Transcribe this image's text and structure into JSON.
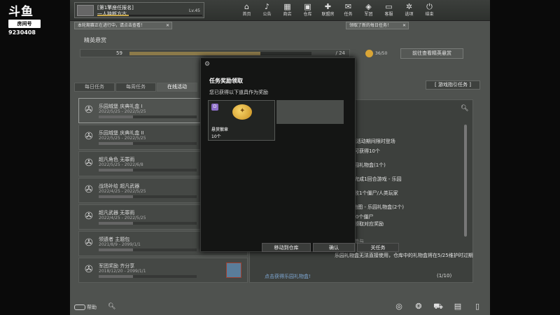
{
  "stream": {
    "brand": "斗鱼",
    "tag": "房间号",
    "room_number": "9230408"
  },
  "player": {
    "line1": "[第1擎座任报名]",
    "line2": "一人独断方古",
    "level": "Lv.45"
  },
  "nav": [
    {
      "icon": "home-icon",
      "glyph": "⌂",
      "label": "首页"
    },
    {
      "icon": "speaker-icon",
      "glyph": "♪",
      "label": "公告"
    },
    {
      "icon": "store-icon",
      "glyph": "▦",
      "label": "商店"
    },
    {
      "icon": "inventory-icon",
      "glyph": "▣",
      "label": "仓库"
    },
    {
      "icon": "gamepad-icon",
      "glyph": "✚",
      "label": "联盟房"
    },
    {
      "icon": "mail-icon",
      "glyph": "✉",
      "label": "任务"
    },
    {
      "icon": "shield-icon",
      "glyph": "◈",
      "label": "军团"
    },
    {
      "icon": "monitor-icon",
      "glyph": "▭",
      "label": "客服"
    },
    {
      "icon": "gear-icon",
      "glyph": "✲",
      "label": "选项"
    },
    {
      "icon": "power-icon",
      "glyph": "⏻",
      "label": "结束"
    }
  ],
  "tickers": {
    "left": "本轮期赛正在进行中，请点击查看！",
    "right": "领取了新的每日任务！",
    "close": "✕"
  },
  "page": {
    "title": "精英悬赏",
    "progress_value": "59",
    "progress_end": "/ 24",
    "gold_count": "36/50",
    "goto_label": "前往查看精英悬赏",
    "bracket_label": "[ 游戏指引任务 ]"
  },
  "tabs": [
    "每日任务",
    "每周任务",
    "在线活动"
  ],
  "tasks": [
    {
      "name": "乐园城堡 庆典礼盒 I",
      "date": "2022/5/25 - 2022/5/25"
    },
    {
      "name": "乐园城堡 庆典礼盒 II",
      "date": "2022/5/25 - 2022/5/25"
    },
    {
      "name": "超凡角色 无罪雨",
      "date": "2022/5/25 - 2022/6/8"
    },
    {
      "name": "战场补给 超凡武器",
      "date": "2022/4/25 - 2022/5/25"
    },
    {
      "name": "超凡武器 无罪雨",
      "date": "2022/4/25 - 2022/5/25"
    },
    {
      "name": "领遗者 主题包",
      "date": "2021/8/9 - 2099/1/1"
    },
    {
      "name": "军团奖励 齐分享",
      "date": "2018/12/20 - 2099/1/1"
    }
  ],
  "details": {
    "lines": [
      {
        "text": "欢乐庄园]活动期间限时登场",
        "dim": false
      },
      {
        "text": "每天最多可获得10个",
        "dim": false
      },
      {
        "text": "地图 - 乐园礼物盒(1个)",
        "dim": false
      },
      {
        "text": "S超越)中完成1回合游戏 - 乐园",
        "dim": false
      },
      {
        "text": "少成功击败1个僵尸/人类玩家",
        "dim": false
      },
      {
        "text": "图/列灭)地图 - 乐园礼物盒(2个)",
        "dim": false
      },
      {
        "text": "中击败100个僵尸",
        "dim": false
      },
      {
        "text": "后，还可领取对应奖励",
        "dim": false
      },
      {
        "text": "方团无法参与",
        "dim": true
      },
      {
        "text": "乐园礼物盒无法直接使用，仓库中的礼物盒将在5/25维护时过期",
        "dim": false
      }
    ],
    "bottom_link": "点击获得乐园礼物盒!",
    "page_count": "(1/10)"
  },
  "modal": {
    "title": "任务奖励领取",
    "subtitle": "您已获得以下道具作为奖励",
    "item_name": "悬赏徽章",
    "item_qty": "10个",
    "badge": "D",
    "buttons": [
      "移动到仓库",
      "确认",
      "关任务"
    ]
  },
  "bottom": {
    "help_label": "帮助"
  },
  "bottom_icons": [
    {
      "icon": "compass-icon",
      "glyph": "◎"
    },
    {
      "icon": "fire-icon",
      "glyph": "❂"
    },
    {
      "icon": "cart-icon",
      "glyph": "⛟"
    },
    {
      "icon": "calendar-icon",
      "glyph": "▤"
    },
    {
      "icon": "battery-icon",
      "glyph": "▯"
    }
  ]
}
